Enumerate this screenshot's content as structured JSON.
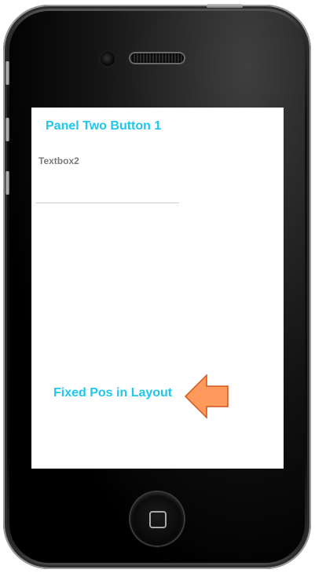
{
  "panel": {
    "button_label": "Panel Two Button 1",
    "textbox_label": "Textbox2",
    "textbox_value": "",
    "fixed_label": "Fixed Pos in Layout"
  },
  "icons": {
    "arrow": "left-arrow-icon",
    "home": "home-button-icon",
    "camera": "front-camera-icon",
    "speaker": "earpiece-speaker-icon"
  },
  "colors": {
    "accent": "#1ec7ef",
    "label_gray": "#7a7a7a",
    "arrow_fill": "#ff9a5c",
    "arrow_stroke": "#d0561a",
    "screen_bg": "#ffffff",
    "device_body": "#000000"
  }
}
